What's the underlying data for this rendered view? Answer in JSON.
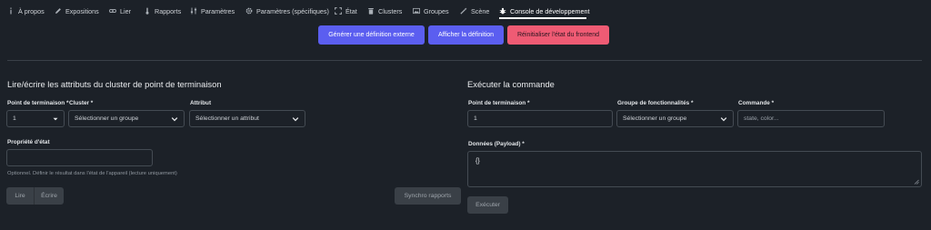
{
  "tabs": [
    {
      "label": "À propos",
      "icon": "info-icon"
    },
    {
      "label": "Expositions",
      "icon": "pencil-icon"
    },
    {
      "label": "Lier",
      "icon": "link-icon"
    },
    {
      "label": "Rapports",
      "icon": "thermometer-icon"
    },
    {
      "label": "Paramètres",
      "icon": "sliders-icon"
    },
    {
      "label": "Paramètres (spécifiques)",
      "icon": "gear-icon"
    },
    {
      "label": "État",
      "icon": "expand-icon"
    },
    {
      "label": "Clusters",
      "icon": "trash-icon"
    },
    {
      "label": "Groupes",
      "icon": "image-icon"
    },
    {
      "label": "Scène",
      "icon": "wand-icon"
    },
    {
      "label": "Console de développement",
      "icon": "bug-icon",
      "active": true
    }
  ],
  "actions": {
    "generate": "Générer une définition externe",
    "show": "Afficher la définition",
    "reset": "Réinitialiser l'état du frontend"
  },
  "read_write": {
    "title": "Lire/écrire les attributs du cluster de point de terminaison",
    "endpoint_label": "Point de terminaison *",
    "endpoint_value": "1",
    "cluster_label": "Cluster *",
    "cluster_placeholder": "Sélectionner un groupe",
    "attribute_label": "Attribut",
    "attribute_placeholder": "Sélectionner un attribut",
    "state_prop_label": "Propriété d'état",
    "state_prop_value": "",
    "help": "Optionnel. Définir le résultat dans l'état de l'appareil (lecture uniquement)",
    "read_button": "Lire",
    "write_button": "Écrire",
    "sync_button": "Synchro rapports"
  },
  "execute": {
    "title": "Exécuter la commande",
    "endpoint_label": "Point de terminaison *",
    "endpoint_value": "1",
    "group_label": "Groupe de fonctionnalités *",
    "group_placeholder": "Sélectionner un groupe",
    "command_label": "Commande *",
    "command_placeholder": "state, color...",
    "payload_label": "Données (Payload) *",
    "payload_value": "{}",
    "execute_button": "Exécuter"
  },
  "colors": {
    "background": "#1c2128",
    "accent": "#5b5ef0",
    "danger": "#ef5b74"
  }
}
